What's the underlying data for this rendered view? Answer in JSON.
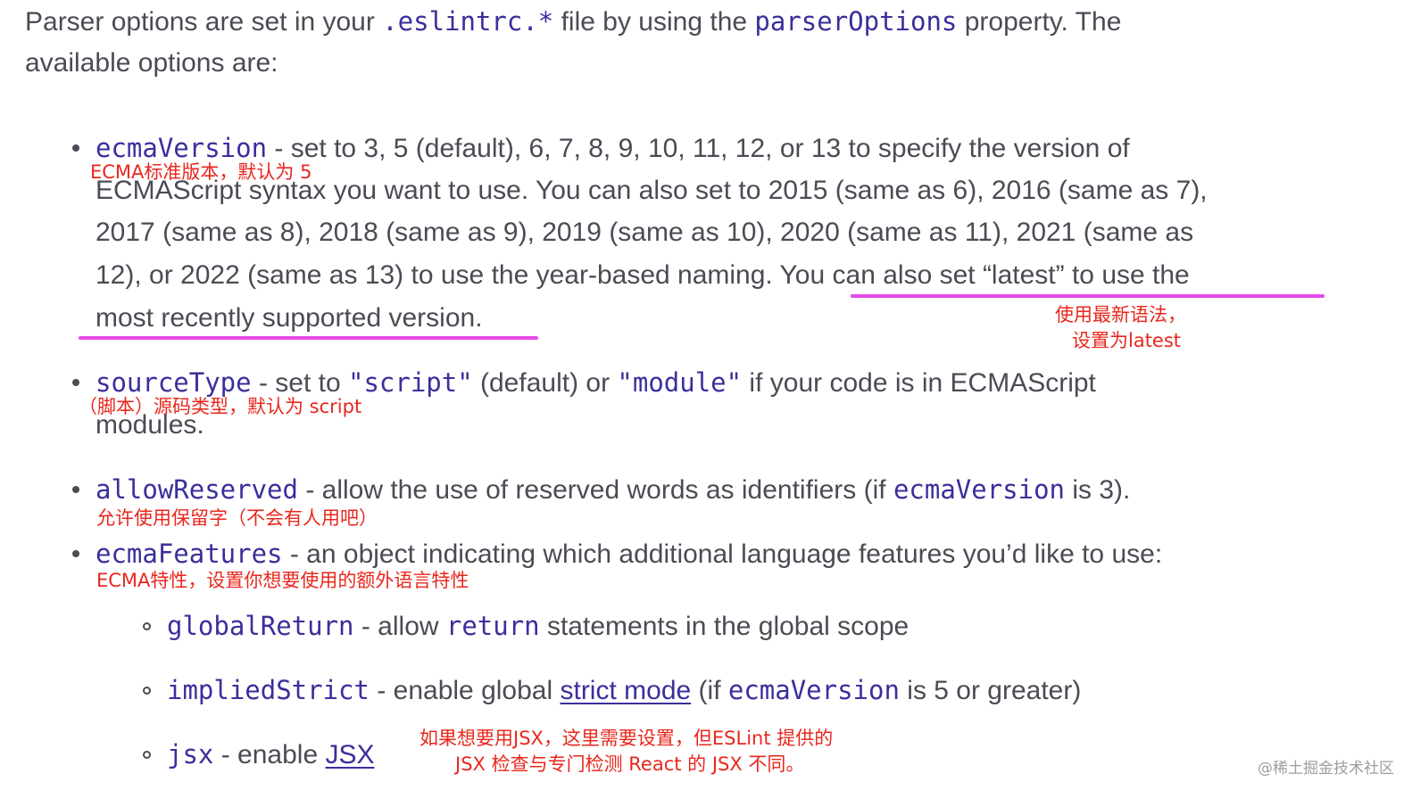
{
  "intro": {
    "part1": "Parser options are set in your ",
    "file_code": ".eslintrc.*",
    "part2": " file by using the ",
    "prop_code": "parserOptions",
    "part3": " property. The",
    "line2": "available options are:"
  },
  "options": {
    "ecmaVersion": {
      "name": "ecmaVersion",
      "line1": " - set to 3, 5 (default), 6, 7, 8, 9, 10, 11, 12, or 13 to specify the version of",
      "line2": "ECMAScript syntax you want to use. You can also set to 2015 (same as 6), 2016 (same as 7),",
      "line3": "2017 (same as 8), 2018 (same as 9), 2019 (same as 10), 2020 (same as 11), 2021 (same as",
      "line4": "12), or 2022 (same as 13) to use the year-based naming. You can also set “latest” to use the",
      "line5": "most recently supported version.",
      "note": "ECMA标准版本，默认为 5",
      "note2_line1": "使用最新语法，",
      "note2_line2": "设置为latest"
    },
    "sourceType": {
      "name": "sourceType",
      "text1": " - set to ",
      "code1": "\"script\"",
      "text2": " (default) or ",
      "code2": "\"module\"",
      "text3": " if your code is in ECMAScript",
      "line2": "modules.",
      "note": "（脚本）源码类型，默认为 script"
    },
    "allowReserved": {
      "name": "allowReserved",
      "text1": " - allow the use of reserved words as identifiers (if ",
      "code": "ecmaVersion",
      "text2": " is 3).",
      "note": "允许使用保留字（不会有人用吧）"
    },
    "ecmaFeatures": {
      "name": "ecmaFeatures",
      "text": " - an object indicating which additional language features you’d like to use:",
      "note": "ECMA特性，设置你想要使用的额外语言特性"
    }
  },
  "features": {
    "globalReturn": {
      "name": "globalReturn",
      "text1": " - allow ",
      "code": "return",
      "text2": " statements in the global scope"
    },
    "impliedStrict": {
      "name": "impliedStrict",
      "text1": " - enable global ",
      "link": "strict mode",
      "text2": " (if ",
      "code": "ecmaVersion",
      "text3": " is 5 or greater)"
    },
    "jsx": {
      "name": "jsx",
      "text1": " - enable ",
      "link": "JSX",
      "note_line1": "如果想要用JSX，这里需要设置，但ESLint 提供的",
      "note_line2": "JSX 检查与专门检测 React 的 JSX 不同。"
    }
  },
  "watermark": "@稀土掘金技术社区",
  "colors": {
    "body_text": "#4b4b55",
    "code": "#3a2f9c",
    "annotation": "#e8271d",
    "underline": "#e54ae8"
  }
}
